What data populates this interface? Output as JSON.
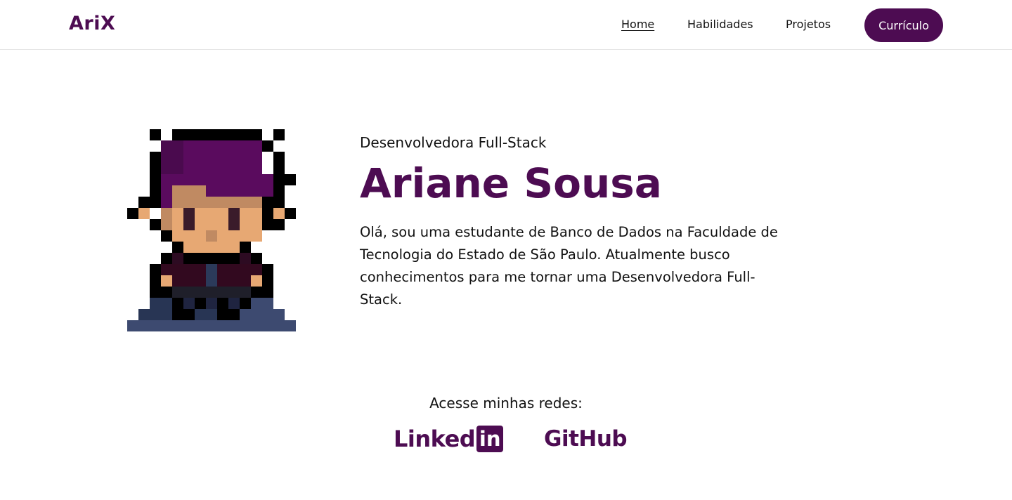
{
  "nav": {
    "logo": "AriX",
    "links": [
      "Home",
      "Habilidades",
      "Projetos"
    ],
    "active": "Home",
    "cv_button": "Currículo"
  },
  "hero": {
    "subtitle": "Desenvolvedora Full-Stack",
    "name": "Ariane Sousa",
    "bio": "Olá, sou uma estudante de Banco de Dados na Faculdade de Tecnologia do Estado de São Paulo. Atualmente busco conhecimentos para me tornar uma Desenvolvedora Full-Stack.",
    "avatar_icon": "pixel-art-avatar-icon"
  },
  "socials": {
    "title": "Acesse minhas redes:",
    "linkedin_text": "Linked",
    "linkedin_badge": "in",
    "github_text": "GitHub"
  },
  "colors": {
    "brand": "#4d0c52",
    "text": "#111111",
    "background": "#ffffff"
  }
}
